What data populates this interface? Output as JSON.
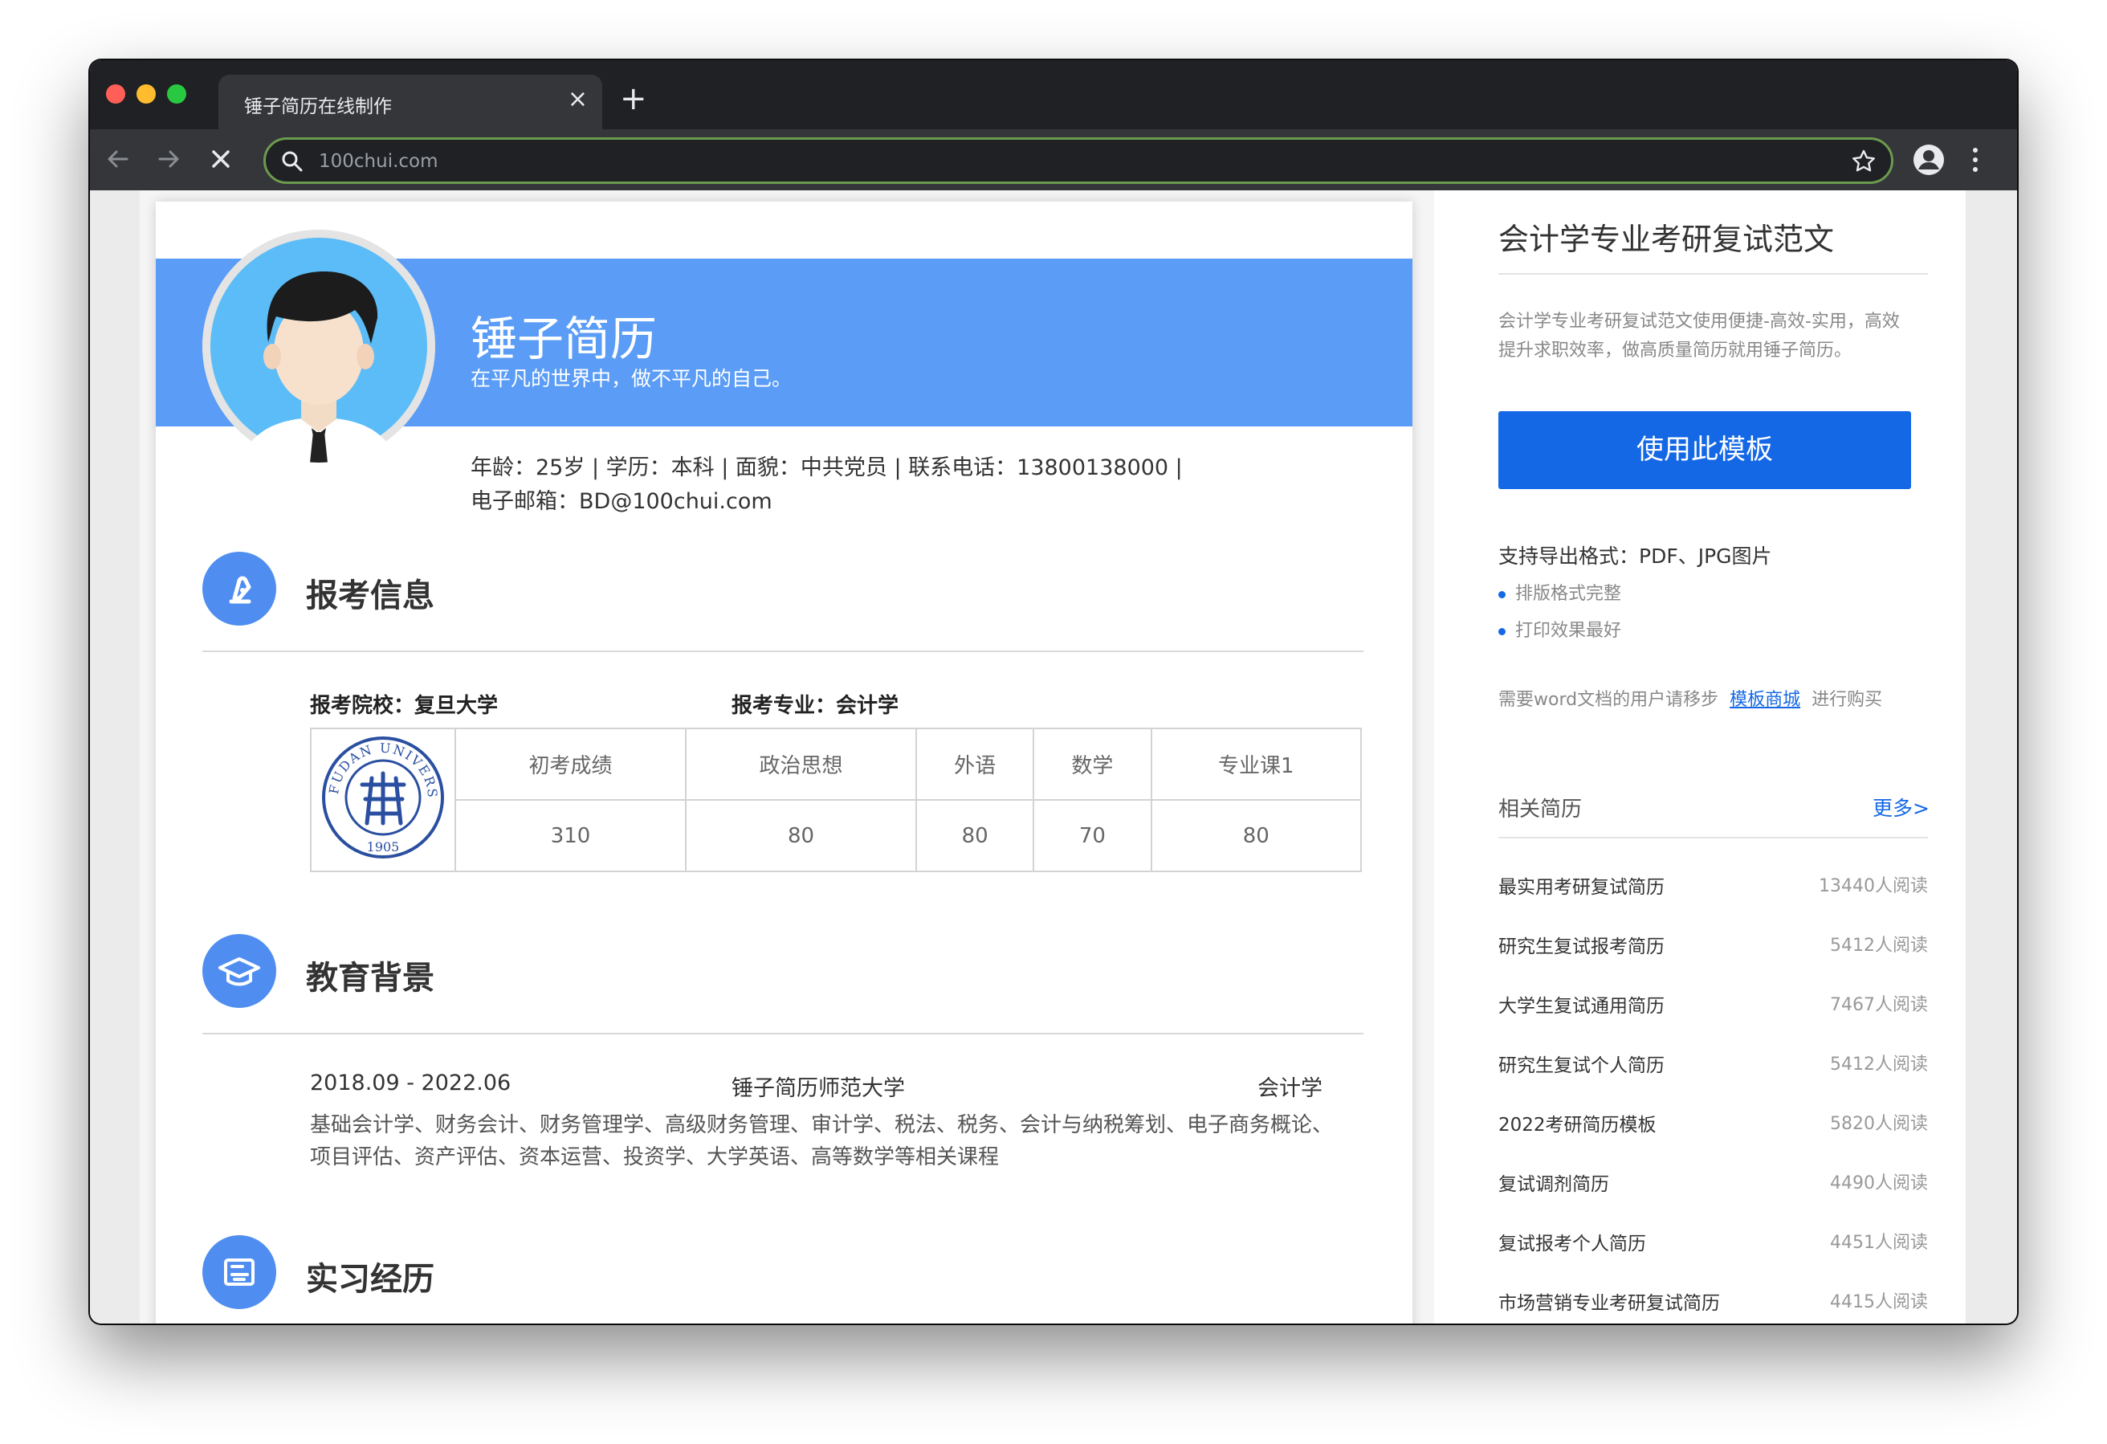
{
  "browser": {
    "tab_title": "锤子简历在线制作",
    "tab_close": "×",
    "new_tab": "+",
    "url": "100chui.com"
  },
  "resume": {
    "name": "锤子简历",
    "motto": "在平凡的世界中，做不平凡的自己。",
    "info_line1": "年龄：25岁 | 学历：本科 | 面貌：中共党员 | 联系电话：13800138000 |",
    "info_line2": "电子邮箱：BD@100chui.com",
    "section_exam": "报考信息",
    "exam_school": "报考院校：复旦大学",
    "exam_major": "报考专业：会计学",
    "score_headers": [
      "初考成绩",
      "政治思想",
      "外语",
      "数学",
      "专业课1"
    ],
    "score_values": [
      "310",
      "80",
      "80",
      "70",
      "80"
    ],
    "section_edu": "教育背景",
    "edu_period": "2018.09 - 2022.06",
    "edu_school": "锤子简历师范大学",
    "edu_major": "会计学",
    "edu_desc1": "基础会计学、财务会计、财务管理学、高级财务管理、审计学、税法、税务、会计与纳税筹划、电子商务概论、",
    "edu_desc2": "项目评估、资产评估、资本运营、投资学、大学英语、高等数学等相关课程",
    "section_intern": "实习经历"
  },
  "sidebar": {
    "title": "会计学专业考研复试范文",
    "desc1": "会计学专业考研复试范文使用便捷-高效-实用，高效",
    "desc2": "提升求职效率，做高质量简历就用锤子简历。",
    "use_button": "使用此模板",
    "export_formats": "支持导出格式：PDF、JPG图片",
    "bullets": [
      "排版格式完整",
      "打印效果最好"
    ],
    "shop_prefix": "需要word文档的用户请移步",
    "shop_link": "模板商城",
    "shop_suffix": "进行购买",
    "related_heading": "相关简历",
    "more_link": "更多>",
    "related": [
      {
        "name": "最实用考研复试简历",
        "count": "13440人阅读"
      },
      {
        "name": "研究生复试报考简历",
        "count": "5412人阅读"
      },
      {
        "name": "大学生复试通用简历",
        "count": "7467人阅读"
      },
      {
        "name": "研究生复试个人简历",
        "count": "5412人阅读"
      },
      {
        "name": "2022考研简历模板",
        "count": "5820人阅读"
      },
      {
        "name": "复试调剂简历",
        "count": "4490人阅读"
      },
      {
        "name": "复试报考个人简历",
        "count": "4451人阅读"
      },
      {
        "name": "市场营销专业考研复试简历",
        "count": "4415人阅读"
      }
    ]
  },
  "logo": {
    "text": "FUDAN UNIVERSITY",
    "year": "1905"
  },
  "colors": {
    "banner": "#5a9cf6",
    "accent": "#1468e6",
    "section_icon": "#4f8ef0",
    "omnibox_border": "#6b9b4e"
  }
}
